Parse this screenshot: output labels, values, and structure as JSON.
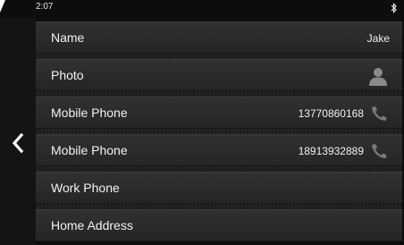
{
  "status_bar": {
    "time": "2:07",
    "bluetooth_icon": "bluetooth-icon"
  },
  "navigation": {
    "back_icon": "chevron-left-icon"
  },
  "contact_fields": [
    {
      "label": "Name",
      "value": "Jake",
      "icon": null
    },
    {
      "label": "Photo",
      "value": "",
      "icon": "person-silhouette-icon"
    },
    {
      "label": "Mobile Phone",
      "value": "13770860168",
      "icon": "phone-handset-icon"
    },
    {
      "label": "Mobile Phone",
      "value": "18913932889",
      "icon": "phone-handset-icon"
    },
    {
      "label": "Work Phone",
      "value": "",
      "icon": null
    },
    {
      "label": "Home Address",
      "value": "",
      "icon": null
    }
  ],
  "colors": {
    "background": "#0d0d0d",
    "row": "#2c2c2c",
    "text": "#f2f2f2",
    "icon": "#8a8a8a"
  }
}
